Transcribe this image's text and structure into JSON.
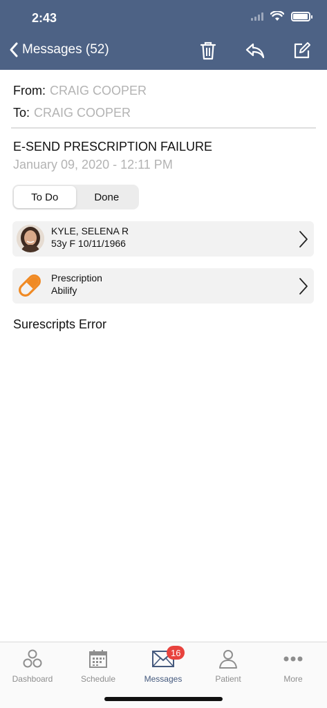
{
  "status_bar": {
    "time": "2:43"
  },
  "nav": {
    "back_label": "Messages (52)"
  },
  "message": {
    "from_label": "From:",
    "from_value": "CRAIG COOPER",
    "to_label": "To:",
    "to_value": "CRAIG COOPER",
    "subject": "E-SEND PRESCRIPTION FAILURE",
    "date": "January 09, 2020 - 12:11 PM",
    "body": "Surescripts Error"
  },
  "status_toggle": {
    "options": [
      "To Do",
      "Done"
    ],
    "selected": "To Do"
  },
  "patient_card": {
    "name": "KYLE, SELENA R",
    "details": "53y F 10/11/1966"
  },
  "rx_card": {
    "label": "Prescription",
    "drug": "Abilify",
    "icon": "pill-icon"
  },
  "tabbar": {
    "tabs": [
      {
        "label": "Dashboard",
        "icon": "dashboard-icon"
      },
      {
        "label": "Schedule",
        "icon": "calendar-icon"
      },
      {
        "label": "Messages",
        "icon": "envelope-icon",
        "badge": "16"
      },
      {
        "label": "Patient",
        "icon": "person-icon"
      },
      {
        "label": "More",
        "icon": "more-icon"
      }
    ],
    "active": "Messages"
  },
  "colors": {
    "nav": "#4d6285",
    "accent": "#44597d",
    "badge": "#e8433e",
    "pill": "#f08a24"
  }
}
